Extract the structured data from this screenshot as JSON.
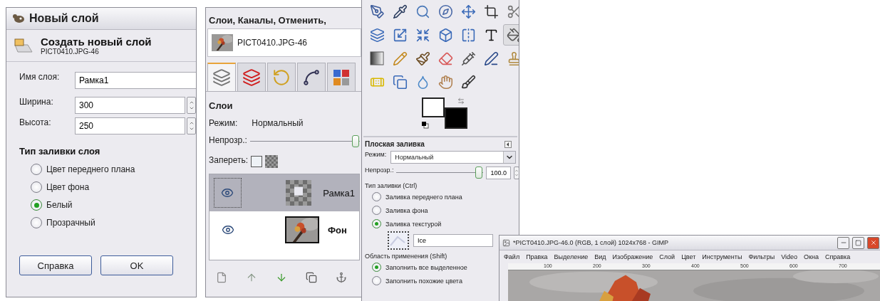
{
  "new_layer_dialog": {
    "title": "Новый слой",
    "heading": "Создать новый слой",
    "image_name": "PICT0410.JPG-46",
    "fields": [
      {
        "kind": "text",
        "label": "Имя слоя:",
        "value": "Рамка1"
      },
      {
        "kind": "spin",
        "label": "Ширина:",
        "value": "300"
      },
      {
        "kind": "spin",
        "label": "Высота:",
        "value": "250"
      }
    ],
    "fill_type": {
      "title": "Тип заливки слоя",
      "options": [
        {
          "label": "Цвет переднего плана",
          "selected": false
        },
        {
          "label": "Цвет фона",
          "selected": false
        },
        {
          "label": "Белый",
          "selected": true
        },
        {
          "label": "Прозрачный",
          "selected": false
        }
      ]
    },
    "buttons": [
      "Справка",
      "OK"
    ]
  },
  "layers_dock": {
    "title": "Слои, Каналы, Отменить,",
    "image": "PICT0410.JPG-46",
    "tabs": [
      {
        "selected": true
      },
      {
        "selected": false
      },
      {
        "selected": false
      },
      {
        "selected": false
      },
      {
        "selected": false
      }
    ],
    "heading": "Слои",
    "mode_label": "Режим:",
    "mode": "Нормальный",
    "opacity_label": "Непрозр.:",
    "opacity": {
      "level": 1.0
    },
    "lock_label": "Запереть:",
    "lock_pixels": {
      "checked": false
    },
    "layers": [
      {
        "name": "Рамка1",
        "visible": true,
        "selected": true,
        "has_alpha": true
      },
      {
        "name": "Фон",
        "visible": true,
        "selected": false,
        "has_alpha": false
      }
    ]
  },
  "toolbox": {
    "tools": [
      {
        "selected": false
      },
      {
        "selected": false
      },
      {
        "selected": false
      },
      {
        "selected": false
      },
      {
        "selected": false
      },
      {
        "selected": false
      },
      {
        "selected": false
      },
      {
        "selected": false
      },
      {
        "selected": false
      },
      {
        "selected": false
      },
      {
        "selected": false
      },
      {
        "selected": false
      },
      {
        "selected": false
      },
      {
        "selected": true
      },
      {
        "selected": false
      },
      {
        "selected": false
      },
      {
        "selected": false
      },
      {
        "selected": false
      },
      {
        "selected": false
      },
      {
        "selected": false
      },
      {
        "selected": false
      },
      {
        "selected": false
      },
      {
        "selected": false
      },
      {
        "selected": false
      },
      {
        "selected": false
      },
      {
        "selected": false
      }
    ],
    "colors": [
      {
        "color": "#ffffff"
      },
      {
        "color": "#000000"
      }
    ]
  },
  "tool_options": {
    "title": "Плоская заливка",
    "mode_label": "Режим:",
    "mode": "Нормальный",
    "opacity_label": "Непрозр.:",
    "opacity": {
      "level": 1.0
    },
    "opacity_value": "100.0",
    "fill_type": {
      "title": "Тип заливки (Ctrl)",
      "options": [
        {
          "label": "Заливка переднего плана",
          "selected": false
        },
        {
          "label": "Заливка фона",
          "selected": false
        },
        {
          "label": "Заливка текстурой",
          "selected": true
        }
      ]
    },
    "pattern": "Ice",
    "area": {
      "title": "Область применения (Shift)",
      "options": [
        {
          "label": "Заполнить все выделенное",
          "selected": true
        },
        {
          "label": "Заполнить похожие цвета",
          "selected": false
        }
      ]
    }
  },
  "image_window": {
    "title": "*PICT0410.JPG-46.0 (RGB, 1 слой) 1024x768 - GIMP",
    "menu": [
      "Файл",
      "Правка",
      "Выделение",
      "Вид",
      "Изображение",
      "Слой",
      "Цвет",
      "Инструменты",
      "Фильтры",
      "Video",
      "Окна",
      "Справка"
    ],
    "ruler_labels": [
      "100",
      "200",
      "300",
      "400",
      "500",
      "600",
      "700"
    ]
  }
}
